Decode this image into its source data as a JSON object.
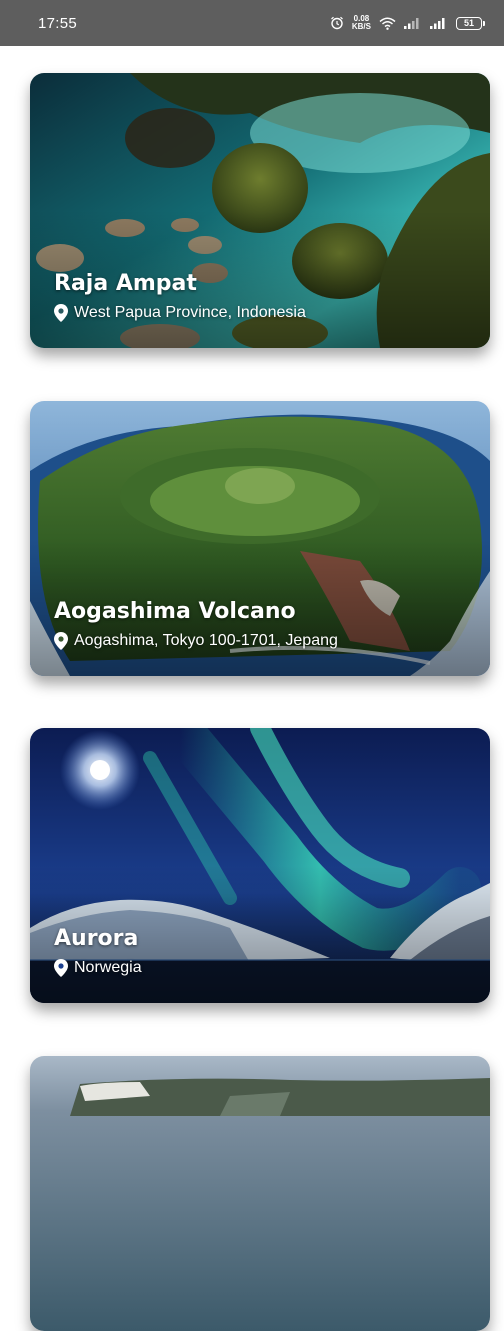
{
  "status_bar": {
    "time": "17:55",
    "speed_value": "0.08",
    "speed_unit": "KB/S",
    "battery": "51"
  },
  "places": [
    {
      "title": "Raja Ampat",
      "location": "West Papua Province, Indonesia"
    },
    {
      "title": "Aogashima Volcano",
      "location": "Aogashima, Tokyo 100-1701, Jepang"
    },
    {
      "title": "Aurora",
      "location": "Norwegia"
    }
  ]
}
